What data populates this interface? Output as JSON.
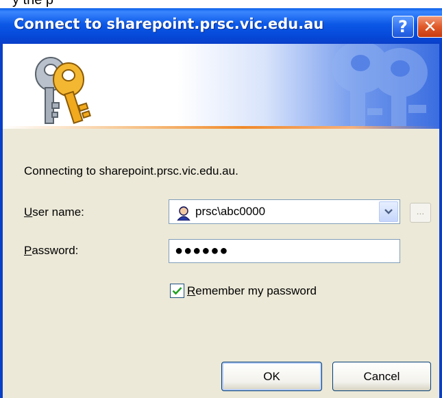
{
  "partial_top_text": "y      the                      p",
  "dialog": {
    "title": "Connect to sharepoint.prsc.vic.edu.au",
    "help_label": "?",
    "close_label": "✕"
  },
  "message": "Connecting to sharepoint.prsc.vic.edu.au.",
  "user_name": {
    "label_accel": "U",
    "label_rest": "ser name:",
    "value": "prsc\\abc0000",
    "browse_label": "..."
  },
  "password": {
    "label_accel": "P",
    "label_rest": "assword:",
    "value": "●●●●●●"
  },
  "remember": {
    "label_accel": "R",
    "label_rest": "emember my password",
    "checked": true
  },
  "buttons": {
    "ok_label": "OK",
    "cancel_label": "Cancel"
  },
  "colors": {
    "titlebar": "#0a5fe8",
    "frame": "#0a3fc8",
    "dialog_bg": "#ece9d8",
    "banner_accent": "#f08a2a"
  }
}
